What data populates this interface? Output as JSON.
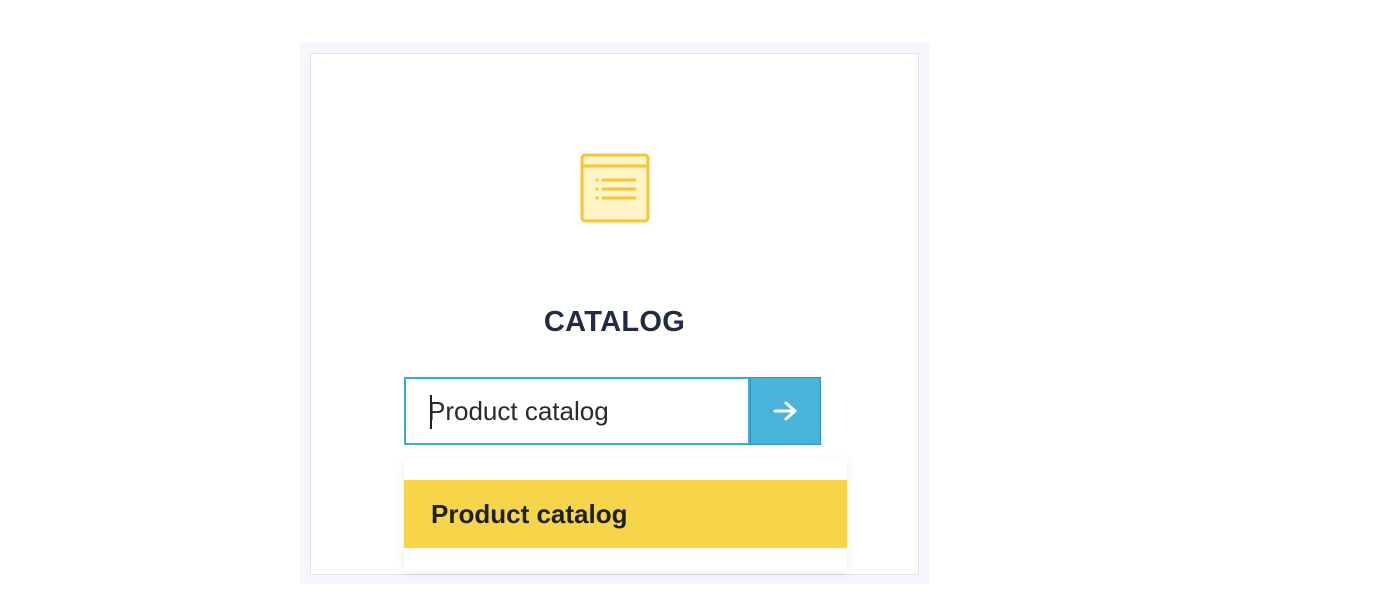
{
  "card": {
    "title": "CATALOG",
    "icon": "catalog-list-icon"
  },
  "search": {
    "value": "Product catalog",
    "submit_icon": "arrow-right-icon"
  },
  "dropdown": {
    "items": [
      {
        "label": "Product catalog",
        "highlighted": true
      }
    ]
  },
  "colors": {
    "accent_blue": "#4ab3d9",
    "input_border": "#3fa9d6",
    "highlight_yellow": "#f7d54a",
    "icon_yellow": "#f6c531",
    "title_text": "#222b45"
  }
}
